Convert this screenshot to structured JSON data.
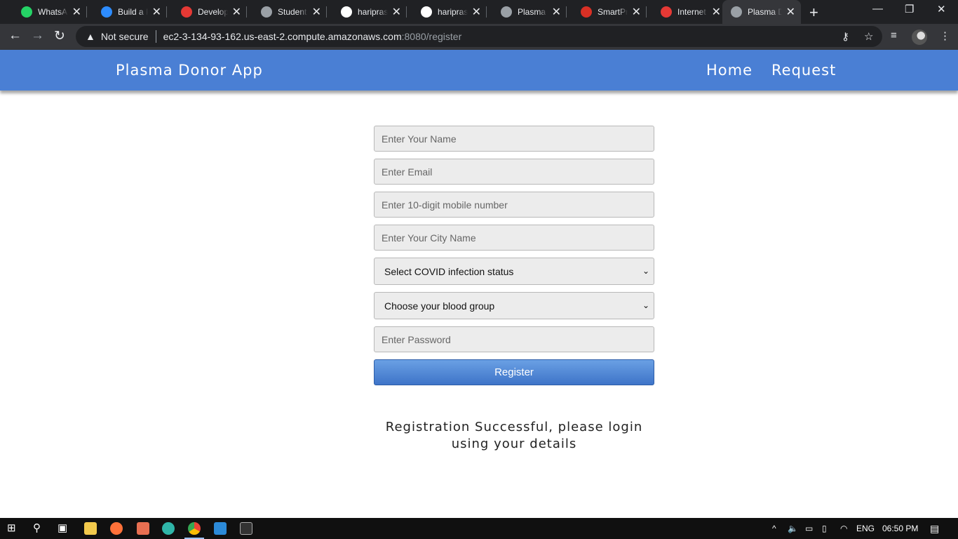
{
  "browser": {
    "tabs": [
      {
        "label": "WhatsApp",
        "icon": "whatsapp-icon",
        "color": "#25d366"
      },
      {
        "label": "Build a Plasma",
        "icon": "zoom-icon",
        "color": "#2d8cff"
      },
      {
        "label": "Developer",
        "icon": "hackerearth-icon",
        "color": "#e53935"
      },
      {
        "label": "Student Dashboard",
        "icon": "globe-icon",
        "color": "#9aa0a6"
      },
      {
        "label": "hariprasad",
        "icon": "github-icon",
        "color": "#ffffff"
      },
      {
        "label": "hariprasad",
        "icon": "github-icon",
        "color": "#ffffff"
      },
      {
        "label": "Plasma Donor",
        "icon": "globe-icon",
        "color": "#9aa0a6"
      },
      {
        "label": "SmartPrix",
        "icon": "gmail-icon",
        "color": "#d93025"
      },
      {
        "label": "Internet Speed",
        "icon": "speedtest-icon",
        "color": "#e53935"
      },
      {
        "label": "Plasma Donor",
        "icon": "globe-icon",
        "color": "#9aa0a6",
        "active": true
      }
    ],
    "security_label": "Not secure",
    "url_host": "ec2-3-134-93-162.us-east-2.compute.amazonaws.com",
    "url_rest": ":8080/register"
  },
  "navbar": {
    "brand": "Plasma Donor App",
    "links": [
      "Home",
      "Request"
    ]
  },
  "form": {
    "name_placeholder": "Enter Your Name",
    "email_placeholder": "Enter Email",
    "mobile_placeholder": "Enter 10-digit mobile number",
    "city_placeholder": "Enter Your City Name",
    "covid_select": "Select COVID infection status",
    "blood_select": "Choose your blood group",
    "password_placeholder": "Enter Password",
    "register_label": "Register"
  },
  "message": "Registration Successful, please login using your details",
  "taskbar": {
    "language": "ENG",
    "time": "06:50 PM"
  }
}
